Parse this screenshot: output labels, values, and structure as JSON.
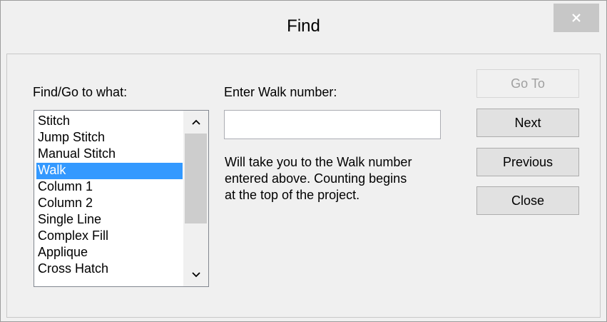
{
  "window": {
    "title": "Find",
    "close_label": "✕"
  },
  "find_label": "Find/Go to what:",
  "list": {
    "items": [
      "Stitch",
      "Jump Stitch",
      "Manual Stitch",
      "Walk",
      "Column 1",
      "Column 2",
      "Single Line",
      "Complex Fill",
      "Applique",
      "Cross Hatch"
    ],
    "selected": "Walk"
  },
  "walk": {
    "label": "Enter Walk number:",
    "value": "",
    "description_lines": [
      "Will take you to the Walk number",
      "entered above.  Counting begins",
      "at the top of the project."
    ]
  },
  "buttons": {
    "goto": "Go To",
    "next": "Next",
    "previous": "Previous",
    "close": "Close"
  },
  "colors": {
    "selection": "#3399ff",
    "background": "#f0f0f0"
  }
}
